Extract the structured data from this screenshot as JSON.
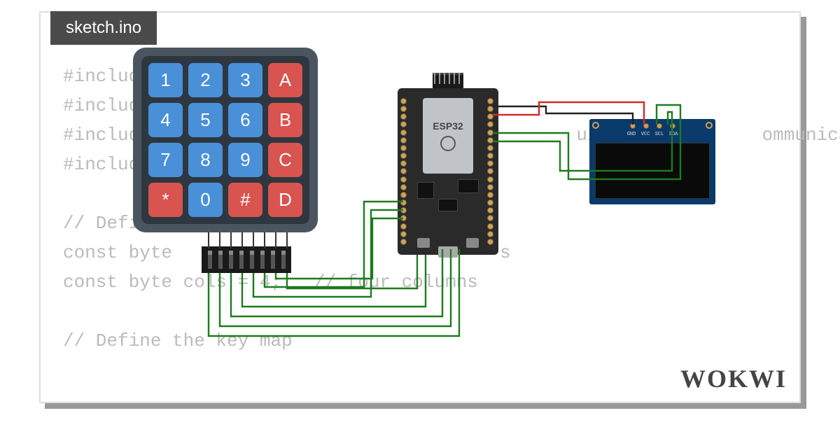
{
  "tab": {
    "filename": "sketch.ino"
  },
  "code_lines": [
    "#include <",
    "#include <",
    "#include <                                     uires            ommunication",
    "#include <",
    "",
    "// Define k",
    "const byte                              s",
    "const byte cols = 4;   // four columns",
    "",
    "// Define the key map"
  ],
  "keypad": {
    "keys": [
      {
        "label": "1",
        "color": "blue"
      },
      {
        "label": "2",
        "color": "blue"
      },
      {
        "label": "3",
        "color": "blue"
      },
      {
        "label": "A",
        "color": "red"
      },
      {
        "label": "4",
        "color": "blue"
      },
      {
        "label": "5",
        "color": "blue"
      },
      {
        "label": "6",
        "color": "blue"
      },
      {
        "label": "B",
        "color": "red"
      },
      {
        "label": "7",
        "color": "blue"
      },
      {
        "label": "8",
        "color": "blue"
      },
      {
        "label": "9",
        "color": "blue"
      },
      {
        "label": "C",
        "color": "red"
      },
      {
        "label": "*",
        "color": "red"
      },
      {
        "label": "0",
        "color": "blue"
      },
      {
        "label": "#",
        "color": "red"
      },
      {
        "label": "D",
        "color": "red"
      }
    ]
  },
  "board": {
    "name": "ESP32"
  },
  "oled": {
    "pin_labels": [
      "GND",
      "VCC",
      "SCL",
      "SDA"
    ]
  },
  "branding": {
    "logo_text": "WOKWI"
  },
  "colors": {
    "wire_green": "#1d7b1d",
    "wire_red": "#d42a2a",
    "wire_black": "#222"
  }
}
